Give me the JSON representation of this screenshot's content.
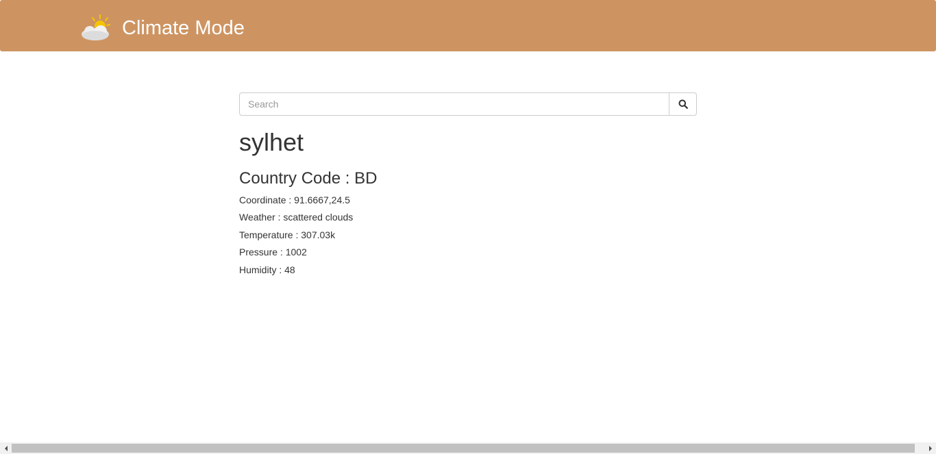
{
  "header": {
    "icon": "partly-cloudy-icon",
    "title": "Climate Mode",
    "background": "#cd9462"
  },
  "search": {
    "placeholder": "Search",
    "value": "",
    "button_icon": "search-icon"
  },
  "result": {
    "city": "sylhet",
    "country_line": "Country Code : BD",
    "coordinate_line": "Coordinate : 91.6667,24.5",
    "weather_line": "Weather : scattered clouds",
    "temperature_line": "Temperature : 307.03k",
    "pressure_line": "Pressure : 1002",
    "humidity_line": "Humidity : 48"
  }
}
